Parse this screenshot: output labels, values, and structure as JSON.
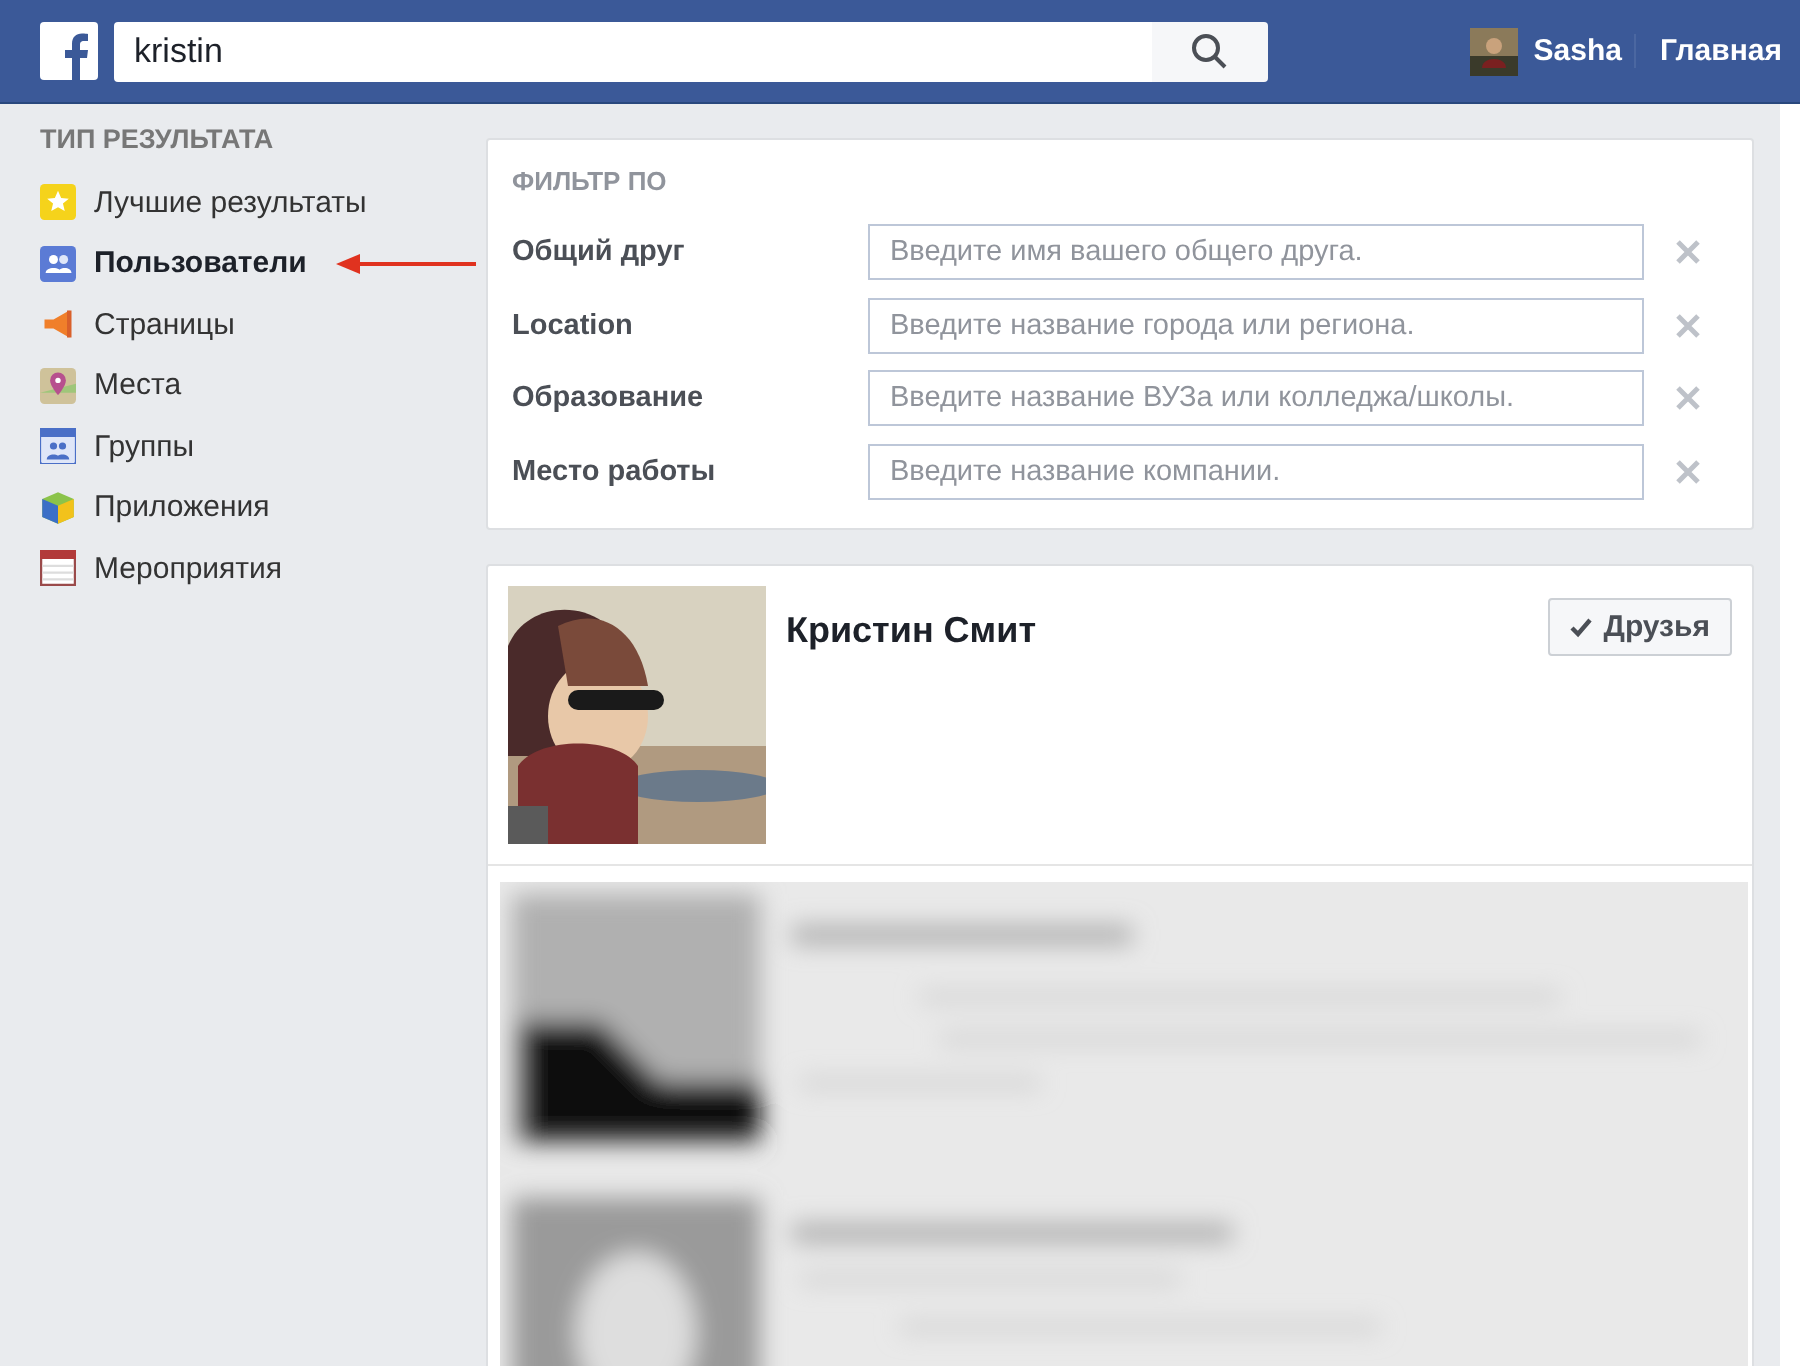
{
  "header": {
    "search": {
      "value": "kristin"
    },
    "user": {
      "name": "Sasha"
    },
    "nav": "Главная"
  },
  "sidebar": {
    "heading": "ТИП РЕЗУЛЬТАТА",
    "items": [
      {
        "label": "Лучшие результаты",
        "kind": "star",
        "selected": false
      },
      {
        "label": "Пользователи",
        "kind": "people",
        "selected": true
      },
      {
        "label": "Страницы",
        "kind": "flag",
        "selected": false
      },
      {
        "label": "Места",
        "kind": "pin",
        "selected": false
      },
      {
        "label": "Группы",
        "kind": "groups",
        "selected": false
      },
      {
        "label": "Приложения",
        "kind": "apps",
        "selected": false
      },
      {
        "label": "Мероприятия",
        "kind": "calendar",
        "selected": false
      }
    ]
  },
  "filter": {
    "heading": "ФИЛЬТР ПО",
    "rows": [
      {
        "label": "Общий друг",
        "placeholder": "Введите имя вашего общего друга."
      },
      {
        "label": "Location",
        "placeholder": "Введите название города или региона."
      },
      {
        "label": "Образование",
        "placeholder": "Введите название ВУЗа или колледжа/школы."
      },
      {
        "label": "Место работы",
        "placeholder": "Введите название компании."
      }
    ]
  },
  "results": [
    {
      "name": "Кристин Смит",
      "button": "Друзья"
    }
  ]
}
